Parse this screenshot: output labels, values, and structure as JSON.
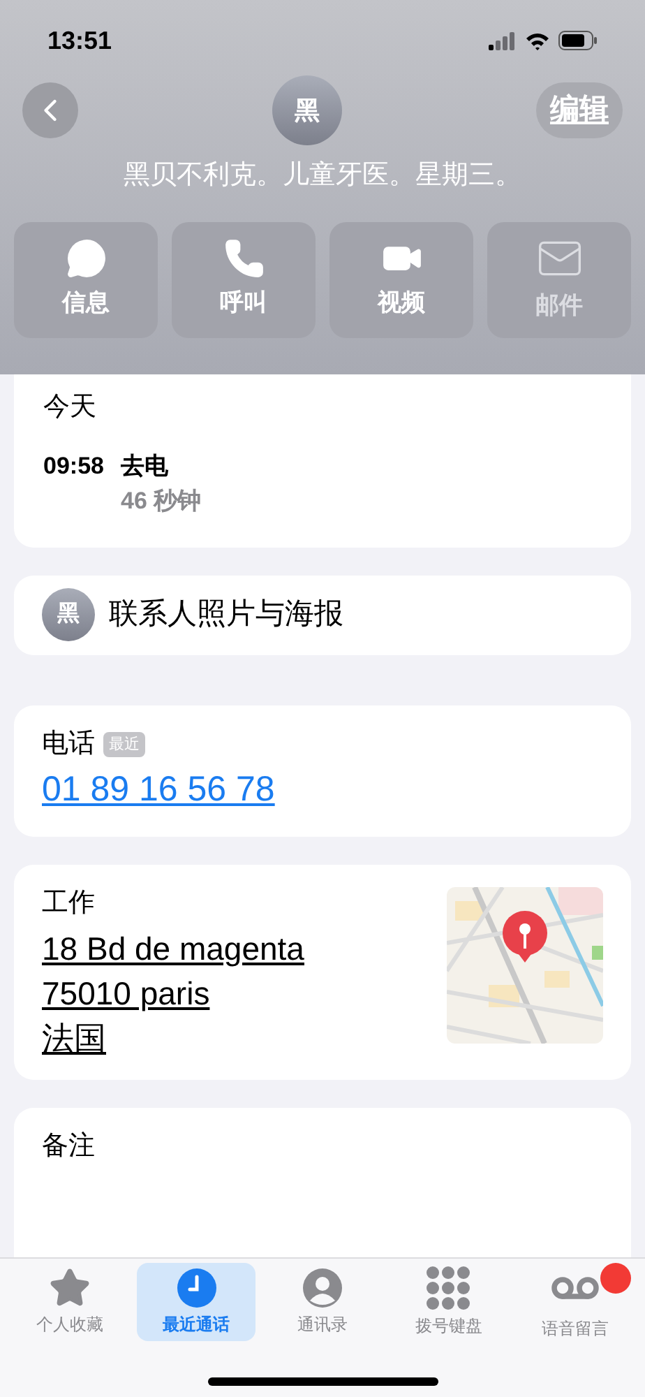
{
  "status_bar": {
    "time": "13:51"
  },
  "header": {
    "avatar_initial": "黑",
    "title": "黑贝不利克。儿童牙医。星期三。",
    "edit_label": "编辑"
  },
  "actions": [
    {
      "kind": "message",
      "label": "信息",
      "disabled": false
    },
    {
      "kind": "call",
      "label": "呼叫",
      "disabled": false
    },
    {
      "kind": "video",
      "label": "视频",
      "disabled": false
    },
    {
      "kind": "mail",
      "label": "邮件",
      "disabled": true
    }
  ],
  "recents": {
    "heading": "今天",
    "calls": [
      {
        "time": "09:58",
        "type": "去电",
        "duration": "46 秒钟"
      }
    ]
  },
  "photo_poster": {
    "avatar_initial": "黑",
    "label": "联系人照片与海报"
  },
  "phone": {
    "label": "电话",
    "badge": "最近",
    "number": "01 89 16 56 78"
  },
  "address": {
    "label": "工作",
    "lines": [
      "18 Bd de magenta",
      "75010 paris",
      "法国"
    ]
  },
  "notes": {
    "label": "备注"
  },
  "tab_bar": [
    {
      "kind": "favorites",
      "label": "个人收藏",
      "selected": false,
      "badge": false
    },
    {
      "kind": "recents",
      "label": "最近通话",
      "selected": true,
      "badge": false
    },
    {
      "kind": "contacts",
      "label": "通讯录",
      "selected": false,
      "badge": false
    },
    {
      "kind": "keypad",
      "label": "拨号键盘",
      "selected": false,
      "badge": false
    },
    {
      "kind": "voicemail",
      "label": "语音留言",
      "selected": false,
      "badge": true
    }
  ]
}
